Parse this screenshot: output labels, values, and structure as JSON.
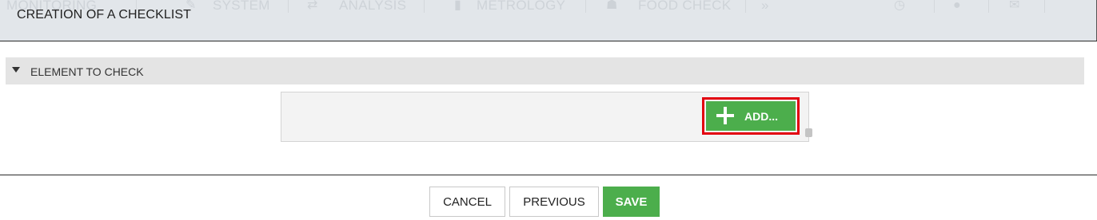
{
  "background_nav": {
    "items": [
      "MONITORING",
      "SYSTEM",
      "ANALYSIS",
      "METROLOGY",
      "FOOD CHECK"
    ],
    "more_glyph": "»"
  },
  "modal": {
    "title": "CREATION OF A CHECKLIST"
  },
  "section": {
    "title": "ELEMENT TO CHECK",
    "expanded": true
  },
  "element_panel": {
    "add_label": "ADD..."
  },
  "footer": {
    "cancel_label": "CANCEL",
    "previous_label": "PREVIOUS",
    "save_label": "SAVE"
  },
  "colors": {
    "accent_green": "#4cae4c",
    "highlight_red": "#e2000f",
    "section_bar": "#e4e4e4"
  }
}
